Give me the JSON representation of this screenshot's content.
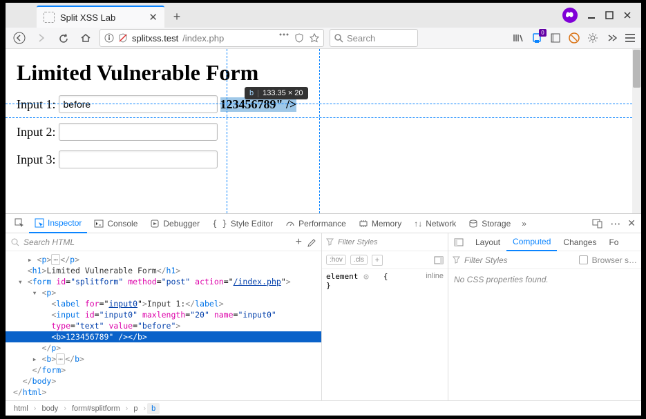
{
  "tab": {
    "title": "Split XSS Lab"
  },
  "url": {
    "domain": "splitxss.test",
    "path": "/index.php"
  },
  "search": {
    "placeholder": "Search"
  },
  "page": {
    "heading": "Limited Vulnerable Form",
    "input1_label": "Input 1:",
    "input1_value": "before",
    "bold_text": "123456789\" />",
    "input2_label": "Input 2:",
    "input3_label": "Input 3:"
  },
  "tooltip": {
    "tag": "b",
    "dims": "133.35 × 20"
  },
  "devtools": {
    "tabs": {
      "inspector": "Inspector",
      "console": "Console",
      "debugger": "Debugger",
      "style": "Style Editor",
      "perf": "Performance",
      "memory": "Memory",
      "network": "Network",
      "storage": "Storage"
    },
    "search_placeholder": "Search HTML",
    "filter_styles": "Filter Styles",
    "hov": ":hov",
    "cls": ".cls",
    "element_label": "element",
    "inline_label": "inline",
    "brace_open": "{",
    "brace_close": "}",
    "right_tabs": {
      "layout": "Layout",
      "computed": "Computed",
      "changes": "Changes",
      "fonts": "Fo"
    },
    "browser_s": "Browser s…",
    "no_css": "No CSS properties found.",
    "tree": {
      "r1": "    ▸ <p>⋯</p>",
      "r2_open": "    <h1>",
      "r2_text": "Limited Vulnerable Form",
      "r2_close": "</h1>",
      "r3": "  ▾ <form id=\"splitform\" method=\"post\" action=\"/index.php\">",
      "r4": "     ▾ <p>",
      "r5a": "         <label for=\"",
      "r5b": "input0",
      "r5c": "\">",
      "r5d": "Input 1:",
      "r5e": "</label>",
      "r6": "         <input id=\"input0\" maxlength=\"20\" name=\"input0\"",
      "r6b": "         type=\"text\" value=\"before\">",
      "r7a": "         <b>",
      "r7b": "123456789\" />",
      "r7c": "</b>",
      "r8": "       </p>",
      "r9": "     ▸ <b>⋯</b>",
      "r10": "     </form>",
      "r11": "   </body>",
      "r12": " </html>"
    },
    "crumbs": [
      "html",
      "body",
      "form#splitform",
      "p",
      "b"
    ]
  }
}
